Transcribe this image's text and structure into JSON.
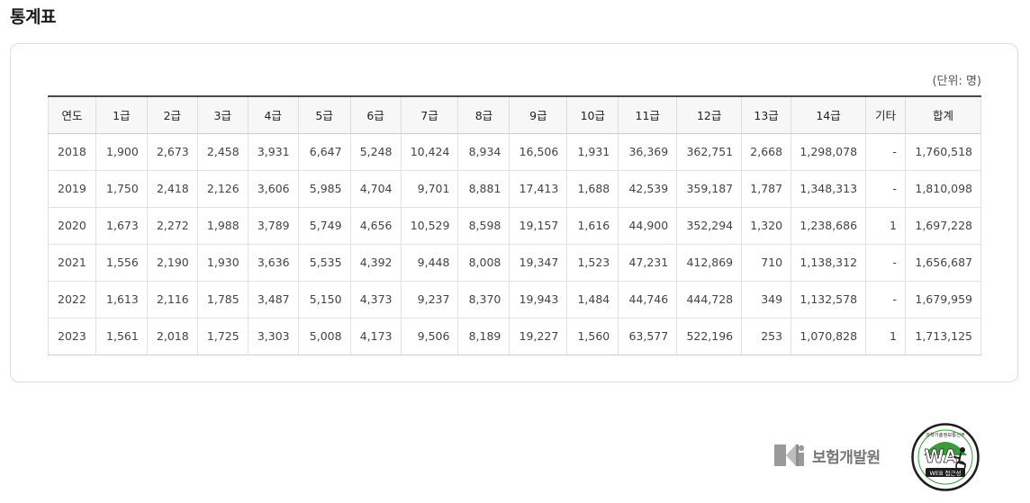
{
  "page": {
    "title": "통계표"
  },
  "table": {
    "unit_note": "(단위: 명)",
    "headers": [
      "연도",
      "1급",
      "2급",
      "3급",
      "4급",
      "5급",
      "6급",
      "7급",
      "8급",
      "9급",
      "10급",
      "11급",
      "12급",
      "13급",
      "14급",
      "기타",
      "합계"
    ],
    "rows": [
      [
        "2018",
        "1,900",
        "2,673",
        "2,458",
        "3,931",
        "6,647",
        "5,248",
        "10,424",
        "8,934",
        "16,506",
        "1,931",
        "36,369",
        "362,751",
        "2,668",
        "1,298,078",
        "-",
        "1,760,518"
      ],
      [
        "2019",
        "1,750",
        "2,418",
        "2,126",
        "3,606",
        "5,985",
        "4,704",
        "9,701",
        "8,881",
        "17,413",
        "1,688",
        "42,539",
        "359,187",
        "1,787",
        "1,348,313",
        "-",
        "1,810,098"
      ],
      [
        "2020",
        "1,673",
        "2,272",
        "1,988",
        "3,789",
        "5,749",
        "4,656",
        "10,529",
        "8,598",
        "19,157",
        "1,616",
        "44,900",
        "352,294",
        "1,320",
        "1,238,686",
        "1",
        "1,697,228"
      ],
      [
        "2021",
        "1,556",
        "2,190",
        "1,930",
        "3,636",
        "5,535",
        "4,392",
        "9,448",
        "8,008",
        "19,347",
        "1,523",
        "47,231",
        "412,869",
        "710",
        "1,138,312",
        "-",
        "1,656,687"
      ],
      [
        "2022",
        "1,613",
        "2,116",
        "1,785",
        "3,487",
        "5,150",
        "4,373",
        "9,237",
        "8,370",
        "19,943",
        "1,484",
        "44,746",
        "444,728",
        "349",
        "1,132,578",
        "-",
        "1,679,959"
      ],
      [
        "2023",
        "1,561",
        "2,018",
        "1,725",
        "3,303",
        "5,008",
        "4,173",
        "9,506",
        "8,189",
        "19,227",
        "1,560",
        "63,577",
        "522,196",
        "253",
        "1,070,828",
        "1",
        "1,713,125"
      ]
    ]
  },
  "footer": {
    "org_name": "보험개발원",
    "org_icon": "kidi-logo-icon",
    "badge": {
      "icon": "web-accessibility-mark-icon",
      "top_text": "과학기술정보통신부",
      "mark": "WA",
      "label": "WEB 접근성",
      "colors": {
        "green": "#3c9a3c",
        "dark": "#1d1d1d"
      }
    }
  }
}
